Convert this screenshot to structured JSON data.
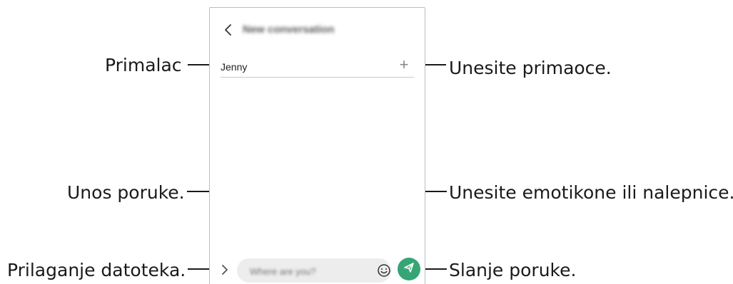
{
  "screen": {
    "title": "New conversation",
    "recipient": "Jenny",
    "plus_symbol": "+",
    "message_placeholder": "Where are you?"
  },
  "callouts": {
    "recipient": "Primalac",
    "enter_recipients": "Unesite primaoce.",
    "message_input": "Unos poruke.",
    "emoticons": "Unesite emotikone ili nalepnice.",
    "attach_files": "Prilaganje datoteka.",
    "send_message": "Slanje poruke."
  },
  "colors": {
    "send_button": "#35a576",
    "input_background": "#ededed"
  },
  "icons": [
    "back-arrow-icon",
    "plus-icon",
    "attach-chevron-icon",
    "emoji-icon",
    "send-icon"
  ]
}
